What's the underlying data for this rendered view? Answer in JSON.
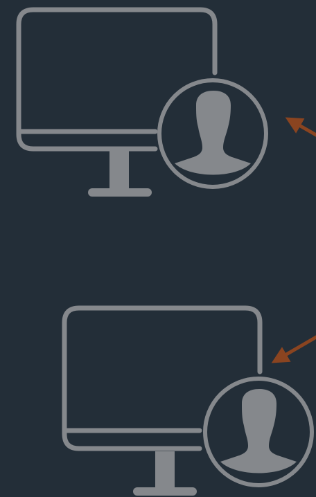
{
  "colors": {
    "background": "#232e38",
    "icon": "#85888c",
    "arrow": "#8a4420"
  },
  "icons": [
    "computer-user-icon",
    "computer-user-icon"
  ],
  "connectors": [
    "arrow-icon",
    "arrow-icon"
  ]
}
